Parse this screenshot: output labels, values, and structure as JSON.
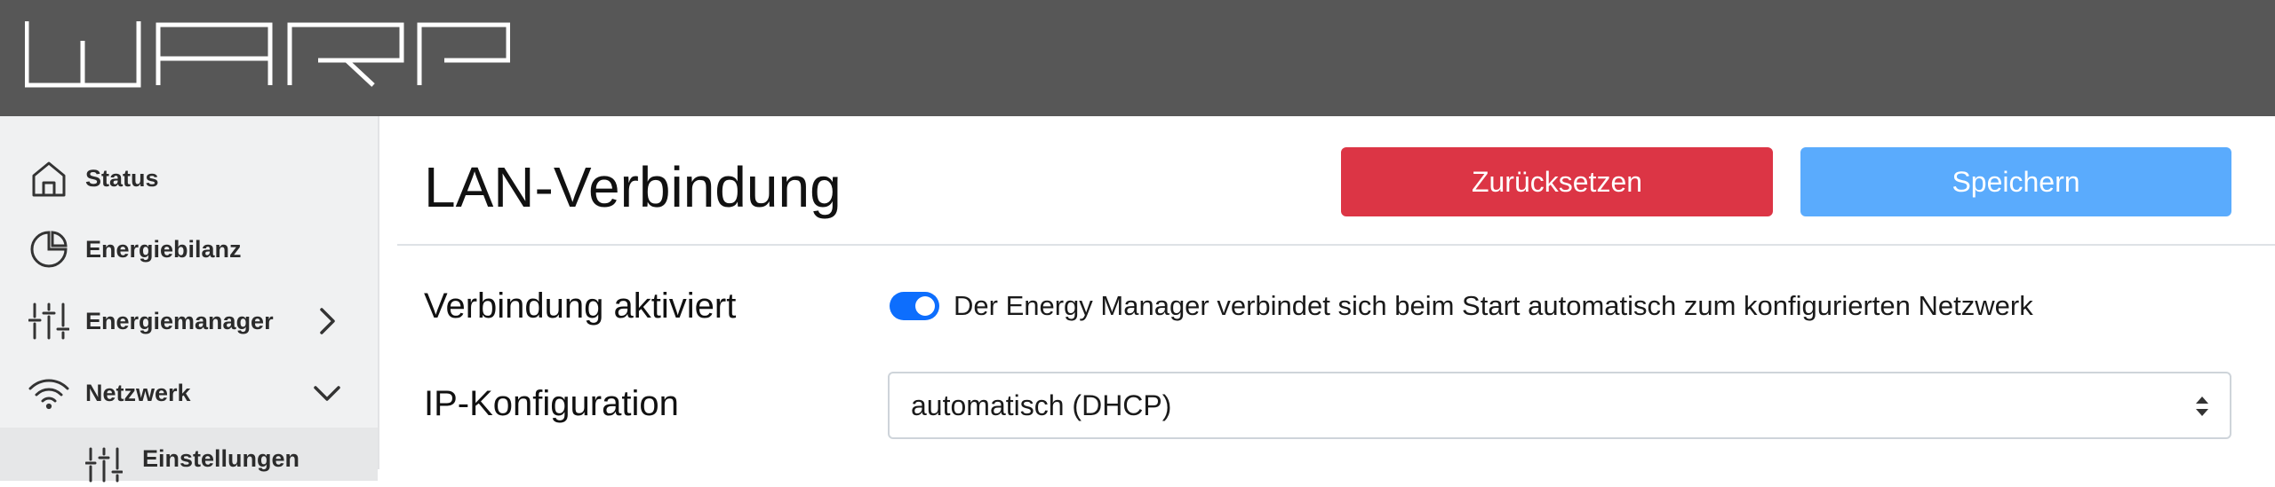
{
  "header": {
    "logo_text": "WARP"
  },
  "sidebar": {
    "items": [
      {
        "label": "Status",
        "icon": "home-icon"
      },
      {
        "label": "Energiebilanz",
        "icon": "pie-chart-icon"
      },
      {
        "label": "Energiemanager",
        "icon": "sliders-icon",
        "expand": "chevron-right-icon"
      },
      {
        "label": "Netzwerk",
        "icon": "wifi-icon",
        "expand": "chevron-down-icon"
      }
    ],
    "subitems": [
      {
        "label": "Einstellungen",
        "icon": "sliders-icon"
      }
    ]
  },
  "main": {
    "title": "LAN-Verbindung",
    "reset_label": "Zurücksetzen",
    "save_label": "Speichern",
    "connection": {
      "label": "Verbindung aktiviert",
      "enabled": true,
      "description": "Der Energy Manager verbindet sich beim Start automatisch zum konfigurierten Netzwerk"
    },
    "ip": {
      "label": "IP-Konfiguration",
      "selected": "automatisch (DHCP)"
    }
  },
  "colors": {
    "topbar": "#575757",
    "sidebar": "#f0f1f2",
    "danger": "#dc3545",
    "primary_light": "#5aabfd",
    "switch_on": "#0d6efd"
  }
}
